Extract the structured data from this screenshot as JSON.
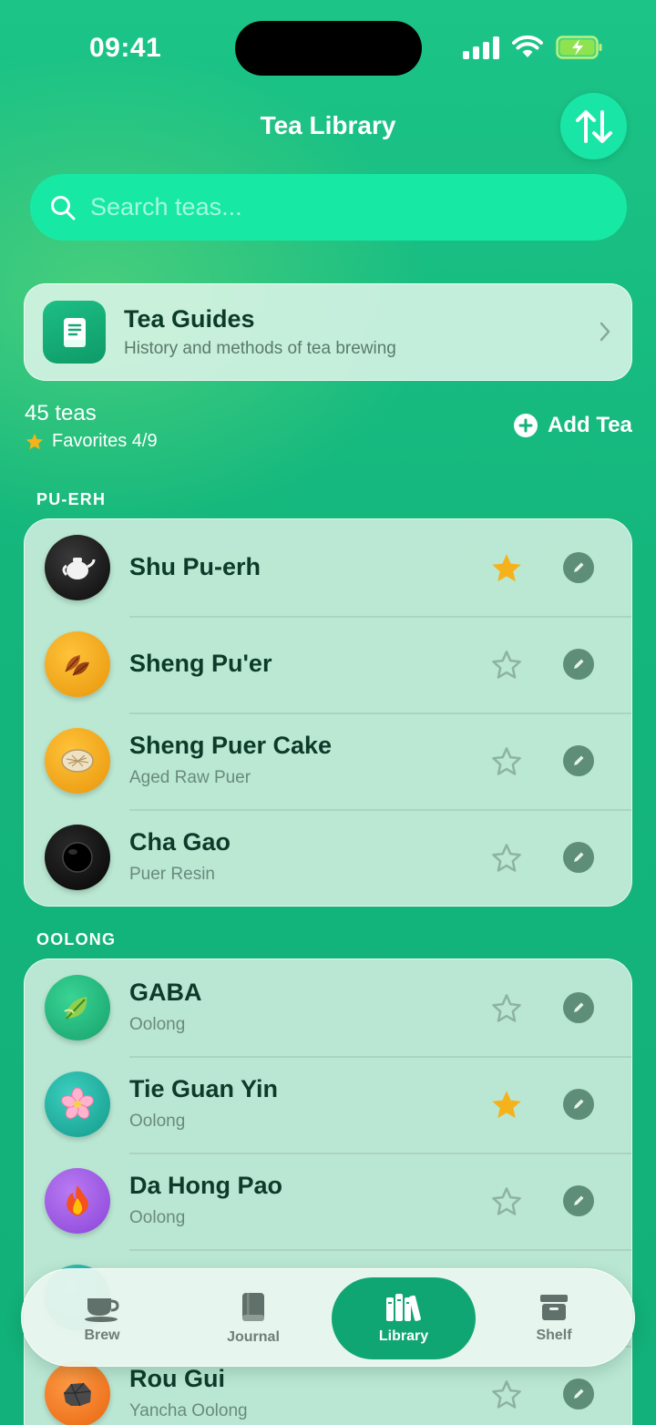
{
  "status_bar": {
    "time": "09:41"
  },
  "header": {
    "title": "Tea Library"
  },
  "search": {
    "placeholder": "Search teas..."
  },
  "guide": {
    "title": "Tea Guides",
    "subtitle": "History and methods of tea brewing"
  },
  "summary": {
    "count": "45 teas",
    "favorites": "Favorites 4/9",
    "add_label": "Add Tea"
  },
  "sections": [
    {
      "label": "PU-ERH",
      "teas": [
        {
          "name": "Shu Pu-erh",
          "subtitle": "",
          "favorite": true,
          "icon": "teapot-icon",
          "color": "#1a1a1a"
        },
        {
          "name": "Sheng Pu'er",
          "subtitle": "",
          "favorite": false,
          "icon": "leaves-icon",
          "color": "#f2a410"
        },
        {
          "name": "Sheng Puer Cake",
          "subtitle": "Aged Raw Puer",
          "favorite": false,
          "icon": "tea-cake-icon",
          "color": "#f2a410"
        },
        {
          "name": "Cha Gao",
          "subtitle": "Puer Resin",
          "favorite": false,
          "icon": "resin-disc-icon",
          "color": "#111111"
        }
      ]
    },
    {
      "label": "OOLONG",
      "teas": [
        {
          "name": "GABA",
          "subtitle": "Oolong",
          "favorite": false,
          "icon": "leaf-icon",
          "color": "#22b77f"
        },
        {
          "name": "Tie Guan Yin",
          "subtitle": "Oolong",
          "favorite": true,
          "icon": "flower-icon",
          "color": "#1fb5a3"
        },
        {
          "name": "Da Hong Pao",
          "subtitle": "Oolong",
          "favorite": false,
          "icon": "fire-icon",
          "color": "#a25ae8"
        },
        {
          "name": "Rou Gui",
          "subtitle": "Yancha Oolong",
          "favorite": false,
          "icon": "rock-icon",
          "color": "#f07a22"
        }
      ]
    }
  ],
  "tabs": [
    {
      "label": "Brew",
      "icon": "cup-icon",
      "active": false
    },
    {
      "label": "Journal",
      "icon": "book-icon",
      "active": false
    },
    {
      "label": "Library",
      "icon": "books-icon",
      "active": true
    },
    {
      "label": "Shelf",
      "icon": "archive-box-icon",
      "active": false
    }
  ],
  "colors": {
    "accent": "#10a673",
    "star_active": "#f5b21b",
    "background": "#14b37a"
  }
}
